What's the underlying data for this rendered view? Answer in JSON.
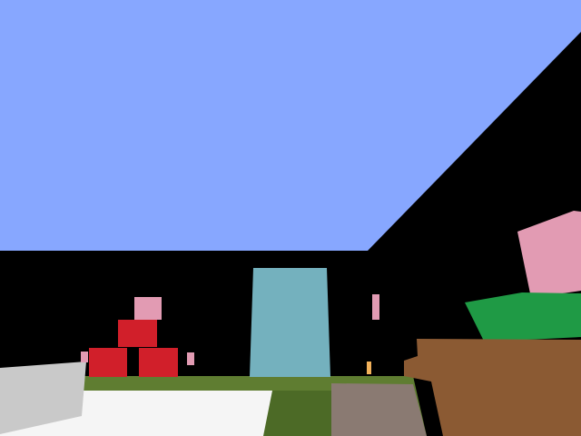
{
  "scene": {
    "view": "first-person",
    "colors": {
      "sky": "#87a7ff",
      "void_wall": "#000000",
      "grass": "#5f7d31",
      "grass_dark": "#4c6a26",
      "snow_block": "#f5f5f5",
      "concrete_light_gray": "#c9c9c9",
      "red_block": "#d11f2a",
      "pink_block": "#e29bb3",
      "cyan_block": "#74b1be",
      "green_block": "#1f9a45",
      "wood_plank": "#8b5a33",
      "stone_block": "#8a7a72",
      "torch": "#f1b15a"
    }
  }
}
